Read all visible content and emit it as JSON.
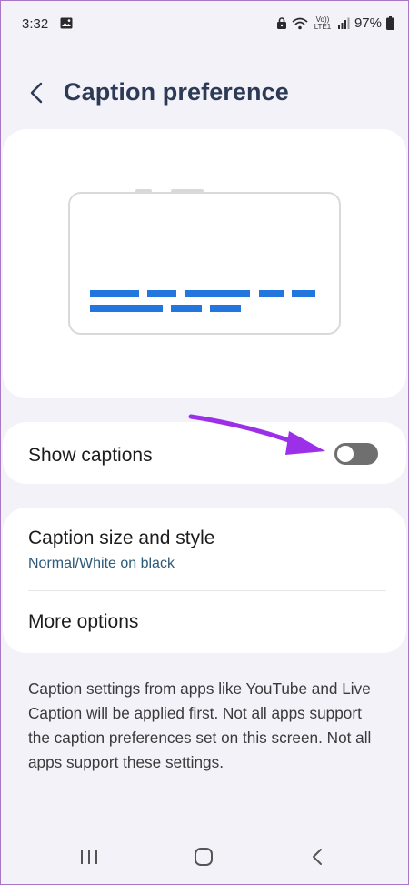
{
  "status_bar": {
    "time": "3:32",
    "battery": "97%",
    "network_label": "Vo)) LTE1"
  },
  "header": {
    "title": "Caption preference"
  },
  "toggle_row": {
    "label": "Show captions",
    "enabled": false
  },
  "settings": {
    "caption_size_title": "Caption size and style",
    "caption_size_value": "Normal/White on black",
    "more_options": "More options"
  },
  "info_text": "Caption settings from apps like YouTube and Live Caption will be applied first. Not all apps support the caption preferences set on this screen. Not all apps support these settings.",
  "colors": {
    "accent": "#2376de",
    "annotation_arrow": "#9b30e8"
  },
  "icons": {
    "back": "chevron-left-icon",
    "recent_apps": "recent-apps-icon",
    "home": "home-icon",
    "nav_back": "nav-back-icon"
  }
}
